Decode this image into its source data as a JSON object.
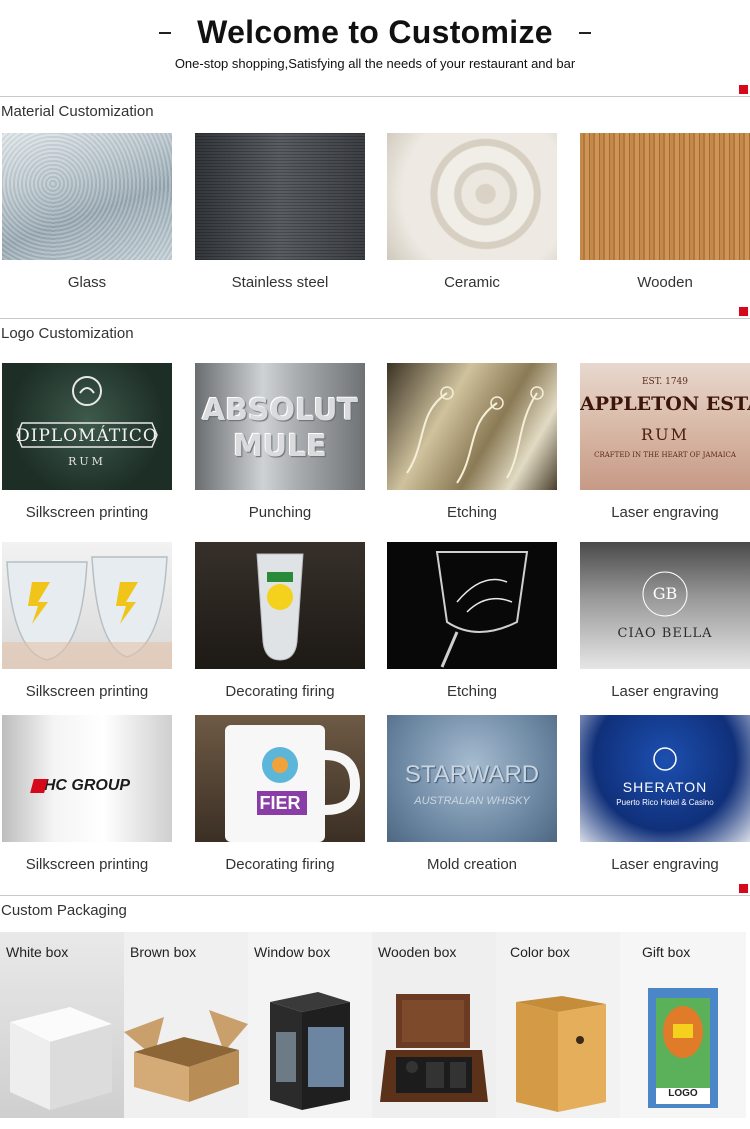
{
  "header": {
    "title": "Welcome to Customize",
    "subtitle": "One-stop shopping,Satisfying all the needs of your restaurant and bar"
  },
  "sections": {
    "material": "Material Customization",
    "logo": "Logo Customization",
    "packaging": "Custom Packaging"
  },
  "materials": [
    {
      "label": "Glass"
    },
    {
      "label": "Stainless steel"
    },
    {
      "label": "Ceramic"
    },
    {
      "label": "Wooden"
    }
  ],
  "logo_rows": [
    [
      {
        "label": "Silkscreen printing",
        "art": "DIPLOMÁTICO",
        "art2": "RUM"
      },
      {
        "label": "Punching",
        "art": "ABSOLUT",
        "art2": "MULE"
      },
      {
        "label": "Etching"
      },
      {
        "label": "Laser engraving",
        "art": "APPLETON ESTATE",
        "art2": "RUM",
        "art3": "EST. 1749",
        "art4": "CRAFTED IN THE HEART OF JAMAICA"
      }
    ],
    [
      {
        "label": "Silkscreen printing"
      },
      {
        "label": "Decorating firing"
      },
      {
        "label": "Etching"
      },
      {
        "label": "Laser engraving",
        "art": "CIAO BELLA",
        "art2": "GB"
      }
    ],
    [
      {
        "label": "Silkscreen printing",
        "art": "HC GROUP"
      },
      {
        "label": "Decorating firing",
        "art": "FIER"
      },
      {
        "label": "Mold creation",
        "art": "STARWARD",
        "art2": "AUSTRALIAN WHISKY"
      },
      {
        "label": "Laser engraving",
        "art": "SHERATON",
        "art2": "Puerto Rico Hotel & Casino"
      }
    ]
  ],
  "packaging": [
    {
      "label": "White box"
    },
    {
      "label": "Brown box"
    },
    {
      "label": "Window box"
    },
    {
      "label": "Wooden box"
    },
    {
      "label": "Color box"
    },
    {
      "label": "Gift box",
      "art": "LOGO"
    }
  ],
  "colors": {
    "accent": "#d6091a",
    "divider": "#c8c8c8"
  }
}
